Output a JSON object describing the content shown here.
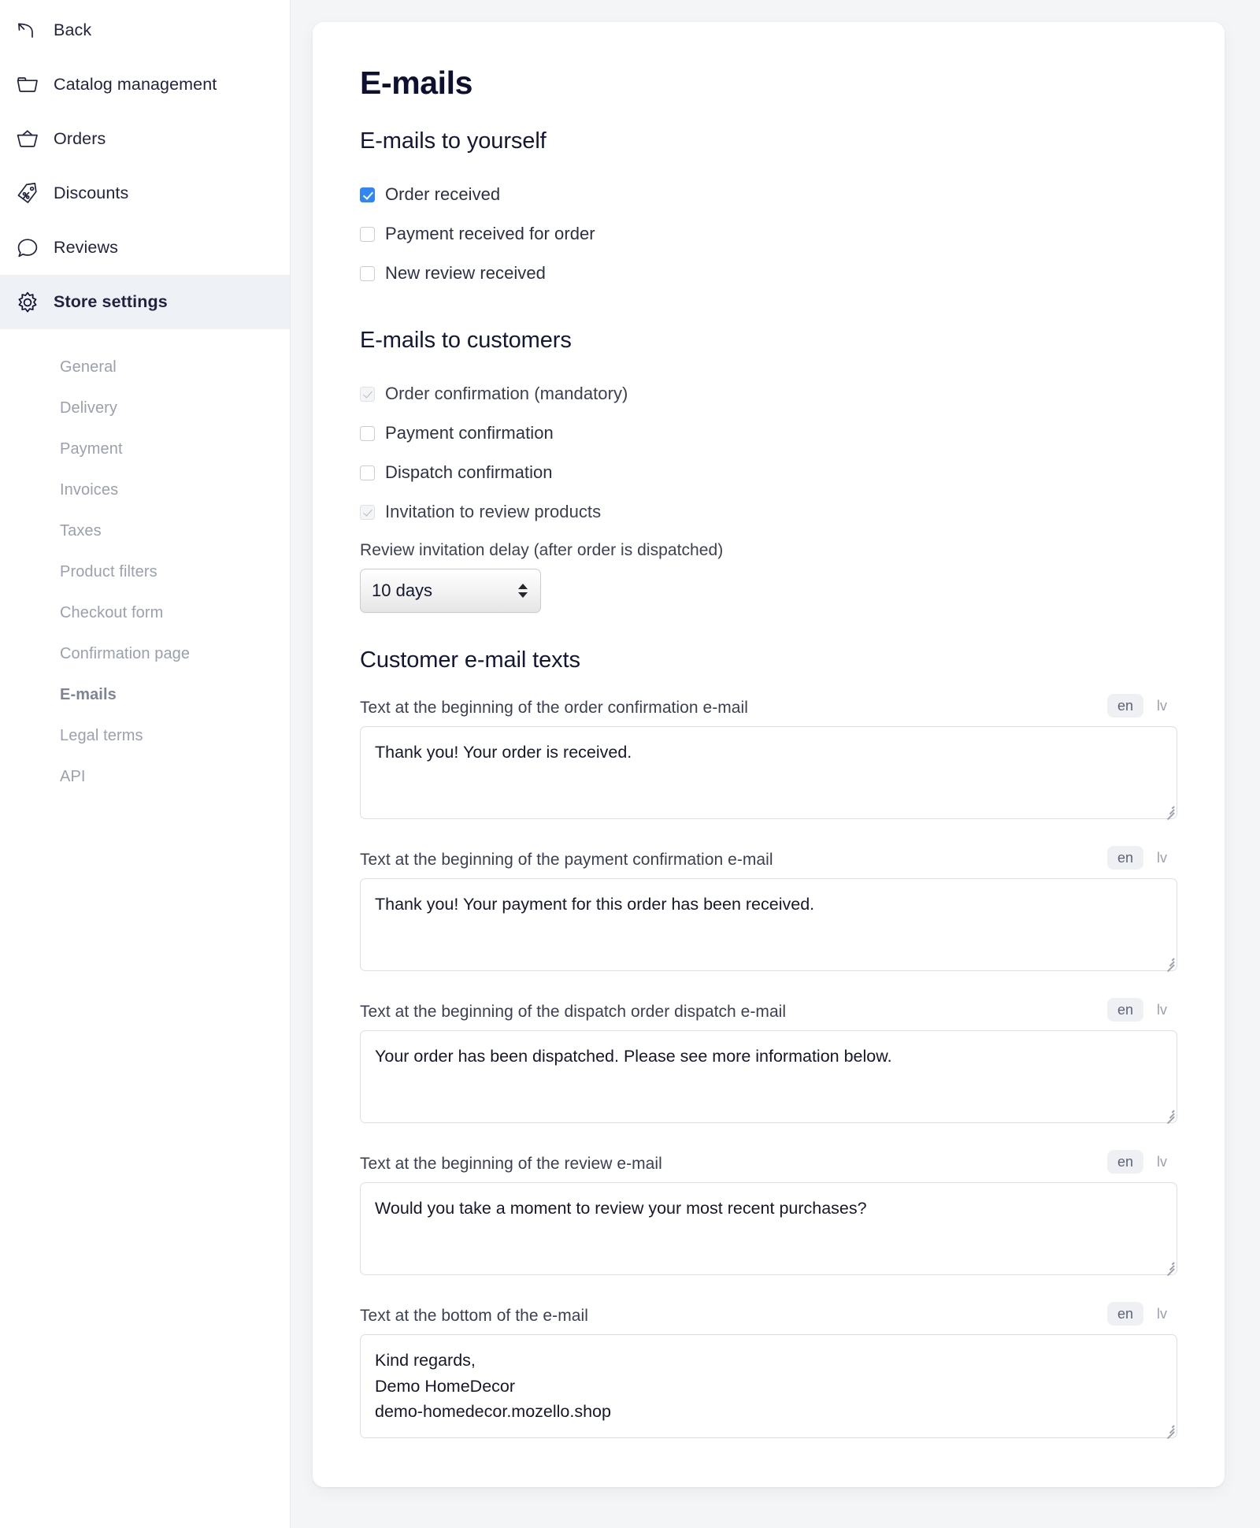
{
  "sidebar": {
    "nav": [
      {
        "label": "Back",
        "icon": "back-arrow-icon",
        "active": false
      },
      {
        "label": "Catalog management",
        "icon": "folder-icon",
        "active": false
      },
      {
        "label": "Orders",
        "icon": "basket-icon",
        "active": false
      },
      {
        "label": "Discounts",
        "icon": "discount-tag-icon",
        "active": false
      },
      {
        "label": "Reviews",
        "icon": "speech-bubble-icon",
        "active": false
      },
      {
        "label": "Store settings",
        "icon": "gear-icon",
        "active": true
      }
    ],
    "subnav": [
      {
        "label": "General",
        "current": false
      },
      {
        "label": "Delivery",
        "current": false
      },
      {
        "label": "Payment",
        "current": false
      },
      {
        "label": "Invoices",
        "current": false
      },
      {
        "label": "Taxes",
        "current": false
      },
      {
        "label": "Product filters",
        "current": false
      },
      {
        "label": "Checkout form",
        "current": false
      },
      {
        "label": "Confirmation page",
        "current": false
      },
      {
        "label": "E-mails",
        "current": true
      },
      {
        "label": "Legal terms",
        "current": false
      },
      {
        "label": "API",
        "current": false
      }
    ]
  },
  "page": {
    "title": "E-mails"
  },
  "self_emails": {
    "title": "E-mails to yourself",
    "items": [
      {
        "label": "Order received",
        "checked": true,
        "locked": false
      },
      {
        "label": "Payment received for order",
        "checked": false,
        "locked": false
      },
      {
        "label": "New review received",
        "checked": false,
        "locked": false
      }
    ]
  },
  "customer_emails": {
    "title": "E-mails to customers",
    "items": [
      {
        "label": "Order confirmation (mandatory)",
        "checked": true,
        "locked": true
      },
      {
        "label": "Payment confirmation",
        "checked": false,
        "locked": false
      },
      {
        "label": "Dispatch confirmation",
        "checked": false,
        "locked": false
      },
      {
        "label": "Invitation to review products",
        "checked": true,
        "locked": true
      }
    ],
    "delay_label": "Review invitation delay (after order is dispatched)",
    "delay_value": "10 days"
  },
  "customer_texts": {
    "title": "Customer e-mail texts",
    "languages": [
      {
        "code": "en",
        "active": true
      },
      {
        "code": "lv",
        "active": false
      }
    ],
    "blocks": [
      {
        "label": "Text at the beginning of the order confirmation e-mail",
        "value": "Thank you! Your order is received."
      },
      {
        "label": "Text at the beginning of the payment confirmation e-mail",
        "value": "Thank you! Your payment for this order has been received."
      },
      {
        "label": "Text at the beginning of the dispatch order dispatch e-mail",
        "value": "Your order has been dispatched. Please see more information below."
      },
      {
        "label": "Text at the beginning of the review e-mail",
        "value": "Would you take a moment to review your most recent purchases?"
      },
      {
        "label": "Text at the bottom of the e-mail",
        "value": "Kind regards,\nDemo HomeDecor\ndemo-homedecor.mozello.shop"
      }
    ]
  },
  "colors": {
    "accent_checkbox": "#2f86f6",
    "sidebar_active_bg": "#eef1f5",
    "page_bg": "#f4f5f7",
    "title_text": "#0d1030",
    "muted_text": "#9aa0b0"
  }
}
